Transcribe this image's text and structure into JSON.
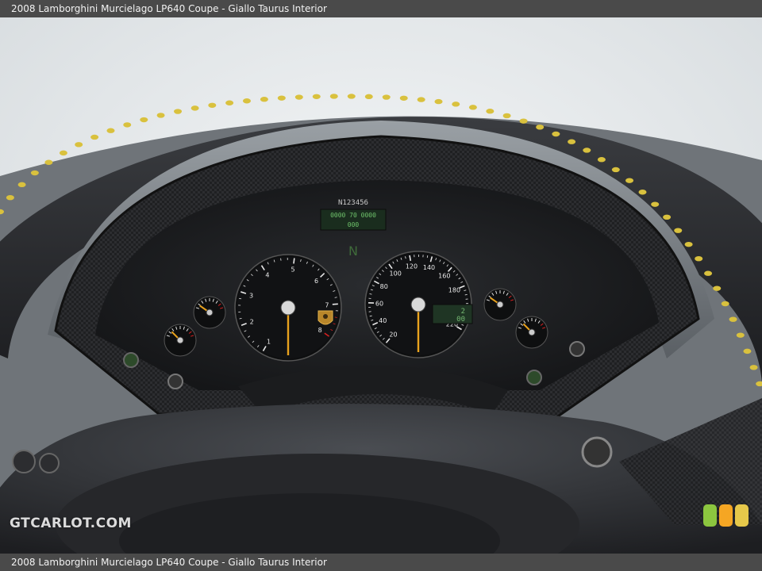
{
  "page": {
    "caption": "2008 Lamborghini Murcielago LP640 Coupe - Giallo Taurus Interior",
    "watermark": "GTCARLOT.COM"
  },
  "cluster": {
    "serial": "N123456",
    "display_line1": "0000 70 0000",
    "display_line2": "000",
    "odometer_lines": [
      "2",
      "00"
    ],
    "gear": "N",
    "tachometer": {
      "ticks": [
        "1",
        "2",
        "3",
        "4",
        "5",
        "6",
        "7",
        "8"
      ]
    },
    "speedometer": {
      "ticks": [
        "20",
        "40",
        "60",
        "80",
        "100",
        "120",
        "140",
        "160",
        "180",
        "200",
        "220"
      ]
    }
  },
  "colors": {
    "stitching": "#d9c13e",
    "needle": "#e8a21d",
    "redline": "#d82020",
    "leather": "#2b2d30",
    "carbon": "#1e1f21"
  },
  "icons": [
    "lamborghini-bull-icon"
  ]
}
